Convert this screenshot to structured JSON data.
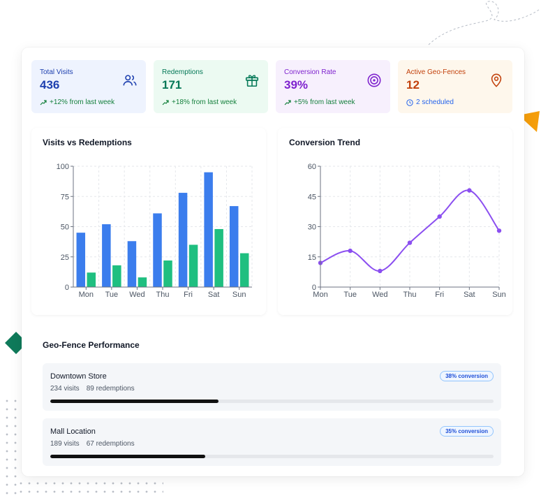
{
  "stats": [
    {
      "label": "Total Visits",
      "value": "436",
      "sub": "+12% from last week",
      "icon": "users-icon",
      "bg": "#eef3fe",
      "accent": "#1e40af",
      "sub_color": "#15803d"
    },
    {
      "label": "Redemptions",
      "value": "171",
      "sub": "+18% from last week",
      "icon": "gift-icon",
      "bg": "#ecfaf2",
      "accent": "#047857",
      "sub_color": "#15803d"
    },
    {
      "label": "Conversion Rate",
      "value": "39%",
      "sub": "+5% from last week",
      "icon": "target-icon",
      "bg": "#f7f0fd",
      "accent": "#7e22ce",
      "sub_color": "#15803d"
    },
    {
      "label": "Active Geo-Fences",
      "value": "12",
      "sub": "2 scheduled",
      "icon": "map-pin-icon",
      "bg": "#fef7ec",
      "accent": "#c2410c",
      "sub_color": "#2563eb"
    }
  ],
  "bar_card": {
    "title": "Visits vs Redemptions"
  },
  "line_card": {
    "title": "Conversion Trend"
  },
  "chart_data": [
    {
      "type": "bar",
      "title": "Visits vs Redemptions",
      "categories": [
        "Mon",
        "Tue",
        "Wed",
        "Thu",
        "Fri",
        "Sat",
        "Sun"
      ],
      "series": [
        {
          "values": [
            45,
            52,
            38,
            61,
            78,
            95,
            67
          ],
          "color": "#3b7ded"
        },
        {
          "values": [
            12,
            18,
            8,
            22,
            35,
            48,
            28
          ],
          "color": "#1fbf80"
        }
      ],
      "ylim": [
        0,
        100
      ],
      "yticks": [
        0,
        25,
        50,
        75,
        100
      ],
      "grid": true
    },
    {
      "type": "line",
      "title": "Conversion Trend",
      "categories": [
        "Mon",
        "Tue",
        "Wed",
        "Thu",
        "Fri",
        "Sat",
        "Sun"
      ],
      "series": [
        {
          "values": [
            12,
            18,
            8,
            22,
            35,
            48,
            28
          ],
          "color": "#8b4ff0"
        }
      ],
      "ylim": [
        0,
        60
      ],
      "yticks": [
        0,
        15,
        30,
        45,
        60
      ],
      "grid": true
    }
  ],
  "geo": {
    "title": "Geo-Fence Performance",
    "items": [
      {
        "name": "Downtown Store",
        "visits": "234 visits",
        "redemptions": "89 redemptions",
        "badge": "38% conversion",
        "progress": 0.38
      },
      {
        "name": "Mall Location",
        "visits": "189 visits",
        "redemptions": "67 redemptions",
        "badge": "35% conversion",
        "progress": 0.35
      }
    ]
  },
  "colors": {
    "triangle": "#f59e0b",
    "diamond": "#0f7a5a"
  }
}
